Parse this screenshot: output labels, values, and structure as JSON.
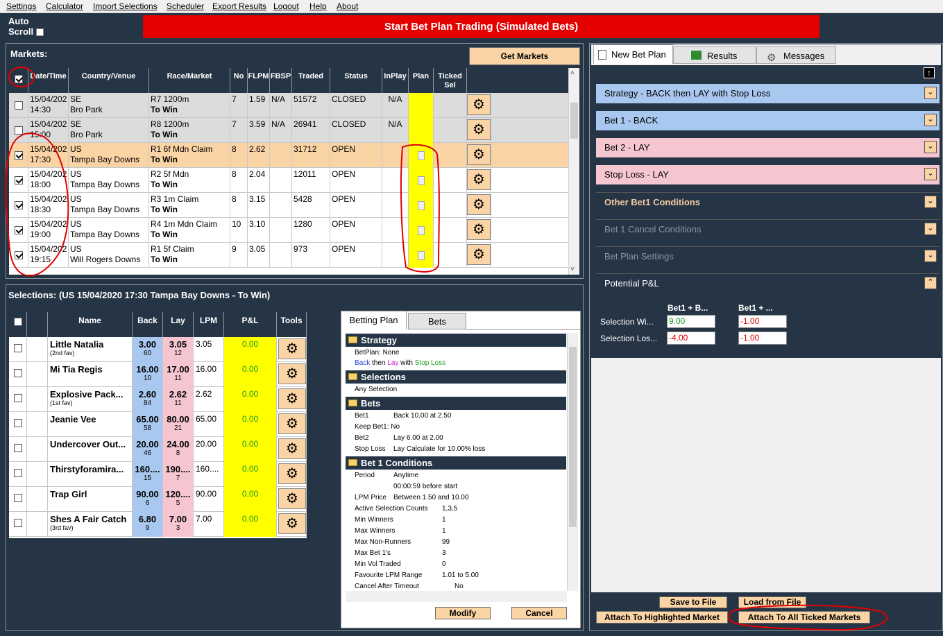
{
  "menu": [
    "Settings",
    "Calculator",
    "Import Selections",
    "Scheduler",
    "Export Results",
    "Logout",
    "Help",
    "About"
  ],
  "autoscroll": {
    "line1": "Auto",
    "line2": "Scroll"
  },
  "banner": "Start Bet Plan Trading (Simulated Bets)",
  "markets": {
    "title": "Markets:",
    "get_button": "Get Markets",
    "columns": [
      "Date/Time",
      "Country/Venue",
      "Race/Market",
      "No",
      "FLPM",
      "FBSP",
      "Traded",
      "Status",
      "InPlay",
      "Plan",
      "Ticked Sel",
      "Tools"
    ],
    "rows": [
      {
        "date": "15/04/202",
        "time": "14:30",
        "country": "SE",
        "venue": "Bro Park",
        "race": "R7 1200m",
        "market": "To Win",
        "no": "7",
        "flpm": "1.59",
        "fbsp": "N/A",
        "traded": "51572",
        "status": "CLOSED",
        "inplay": "N/A",
        "checked": false,
        "plan": false
      },
      {
        "date": "15/04/202",
        "time": "15:00",
        "country": "SE",
        "venue": "Bro Park",
        "race": "R8 1200m",
        "market": "To Win",
        "no": "7",
        "flpm": "3.59",
        "fbsp": "N/A",
        "traded": "26941",
        "status": "CLOSED",
        "inplay": "N/A",
        "checked": false,
        "plan": false
      },
      {
        "date": "15/04/202",
        "time": "17:30",
        "country": "US",
        "venue": "Tampa Bay Downs",
        "race": "R1 6f Mdn Claim",
        "market": "To Win",
        "no": "8",
        "flpm": "2.62",
        "fbsp": "",
        "traded": "31712",
        "status": "OPEN",
        "inplay": "",
        "checked": true,
        "plan": true
      },
      {
        "date": "15/04/202",
        "time": "18:00",
        "country": "US",
        "venue": "Tampa Bay Downs",
        "race": "R2 5f Mdn",
        "market": "To Win",
        "no": "8",
        "flpm": "2.04",
        "fbsp": "",
        "traded": "12011",
        "status": "OPEN",
        "inplay": "",
        "checked": true,
        "plan": true
      },
      {
        "date": "15/04/202",
        "time": "18:30",
        "country": "US",
        "venue": "Tampa Bay Downs",
        "race": "R3 1m Claim",
        "market": "To Win",
        "no": "8",
        "flpm": "3.15",
        "fbsp": "",
        "traded": "5428",
        "status": "OPEN",
        "inplay": "",
        "checked": true,
        "plan": true
      },
      {
        "date": "15/04/202",
        "time": "19:00",
        "country": "US",
        "venue": "Tampa Bay Downs",
        "race": "R4 1m Mdn Claim",
        "market": "To Win",
        "no": "10",
        "flpm": "3.10",
        "fbsp": "",
        "traded": "1280",
        "status": "OPEN",
        "inplay": "",
        "checked": true,
        "plan": true
      },
      {
        "date": "15/04/202",
        "time": "19:15",
        "country": "US",
        "venue": "Will Rogers Downs",
        "race": "R1 5f Claim",
        "market": "To Win",
        "no": "9",
        "flpm": "3.05",
        "fbsp": "",
        "traded": "973",
        "status": "OPEN",
        "inplay": "",
        "checked": true,
        "plan": true
      }
    ]
  },
  "selections": {
    "title": "Selections:  (US 15/04/2020 17:30 Tampa Bay Downs - To Win)",
    "columns": [
      "Name",
      "Back",
      "Lay",
      "LPM",
      "P&L",
      "Tools"
    ],
    "rows": [
      {
        "name": "Little Natalia",
        "sub": "(2nd fav)",
        "back": "3.00",
        "back_vol": "60",
        "lay": "3.05",
        "lay_vol": "12",
        "lpm": "3.05",
        "pl": "0.00"
      },
      {
        "name": "Mi Tia Regis",
        "sub": "",
        "back": "16.00",
        "back_vol": "10",
        "lay": "17.00",
        "lay_vol": "11",
        "lpm": "16.00",
        "pl": "0.00"
      },
      {
        "name": "Explosive Pack...",
        "sub": "(1st fav)",
        "back": "2.60",
        "back_vol": "84",
        "lay": "2.62",
        "lay_vol": "11",
        "lpm": "2.62",
        "pl": "0.00"
      },
      {
        "name": "Jeanie Vee",
        "sub": "",
        "back": "65.00",
        "back_vol": "58",
        "lay": "80.00",
        "lay_vol": "21",
        "lpm": "65.00",
        "pl": "0.00"
      },
      {
        "name": "Undercover Out...",
        "sub": "",
        "back": "20.00",
        "back_vol": "46",
        "lay": "24.00",
        "lay_vol": "8",
        "lpm": "20.00",
        "pl": "0.00"
      },
      {
        "name": "Thirstyforamira...",
        "sub": "",
        "back": "160....",
        "back_vol": "15",
        "lay": "190....",
        "lay_vol": "7",
        "lpm": "160....",
        "pl": "0.00"
      },
      {
        "name": "Trap Girl",
        "sub": "",
        "back": "90.00",
        "back_vol": "6",
        "lay": "120....",
        "lay_vol": "5",
        "lpm": "90.00",
        "pl": "0.00"
      },
      {
        "name": "Shes A Fair Catch",
        "sub": "(3rd fav)",
        "back": "6.80",
        "back_vol": "9",
        "lay": "7.00",
        "lay_vol": "3",
        "lpm": "7.00",
        "pl": "0.00"
      }
    ]
  },
  "betting_plan": {
    "tabs": [
      "Betting Plan",
      "Bets"
    ],
    "sections": {
      "strategy": "Strategy",
      "selections": "Selections",
      "bets": "Bets",
      "bet1cond": "Bet 1 Conditions"
    },
    "strategy_line1": "BetPlan: None",
    "strategy_back": "Back",
    "strategy_then": "then",
    "strategy_lay": "Lay",
    "strategy_with": "with",
    "strategy_stop": "Stop Loss",
    "selections_line": "Any Selection",
    "bets": [
      [
        "Bet1",
        "Back  10.00 at 2.50"
      ],
      [
        "Keep Bet1: No",
        ""
      ],
      [
        "Bet2",
        "Lay    6.00     at    2.00"
      ],
      [
        "Stop Loss",
        "Lay     Calculate for 10.00% loss"
      ]
    ],
    "conditions": [
      [
        "Period",
        "Anytime"
      ],
      [
        "",
        "00:00:59 before start"
      ],
      [
        "LPM Price",
        "Between 1.50 and 10.00"
      ],
      [
        "Active Selection Counts",
        "1,3,5"
      ],
      [
        "Min Winners",
        "1"
      ],
      [
        "Max Winners",
        "1"
      ],
      [
        "Max Non-Runners",
        "99"
      ],
      [
        "Max Bet 1's",
        "3"
      ],
      [
        "Min Vol Traded",
        "0"
      ],
      [
        "Favourite LPM Range",
        "1.01 to 5.00"
      ],
      [
        "Cancel After Timeout",
        "No"
      ]
    ],
    "modify": "Modify",
    "cancel": "Cancel"
  },
  "right": {
    "tabs": [
      "New Bet Plan",
      "Results",
      "Messages"
    ],
    "accordions": [
      {
        "label": "Strategy - BACK then LAY with  Stop Loss",
        "bg": "#a9c8ef",
        "fg": "#000"
      },
      {
        "label": "Bet 1 - BACK",
        "bg": "#a9c8ef",
        "fg": "#000"
      },
      {
        "label": "Bet 2 - LAY",
        "bg": "#f6c6d0",
        "fg": "#000"
      },
      {
        "label": "Stop Loss - LAY",
        "bg": "#f6c6d0",
        "fg": "#000"
      },
      {
        "label": "Other Bet1 Conditions",
        "bg": "#263545",
        "fg": "#f5c9a0"
      },
      {
        "label": "Bet 1 Cancel Conditions",
        "bg": "#263545",
        "fg": "#8c96a0"
      },
      {
        "label": "Bet Plan Settings",
        "bg": "#263545",
        "fg": "#8c96a0"
      },
      {
        "label": "Potential P&L",
        "bg": "#263545",
        "fg": "#fff"
      }
    ],
    "pl": {
      "col1": "Bet1 + B...",
      "col2": "Bet1 + ...",
      "row1": "Selection Wi...",
      "row2": "Selection Los...",
      "v11": "9.00",
      "v12": "-1.00",
      "v21": "-4.00",
      "v22": "-1.00"
    },
    "save": "Save to File",
    "load": "Load from File",
    "attach_highlighted": "Attach To Highlighted Market",
    "attach_all": "Attach To All Ticked Markets"
  }
}
